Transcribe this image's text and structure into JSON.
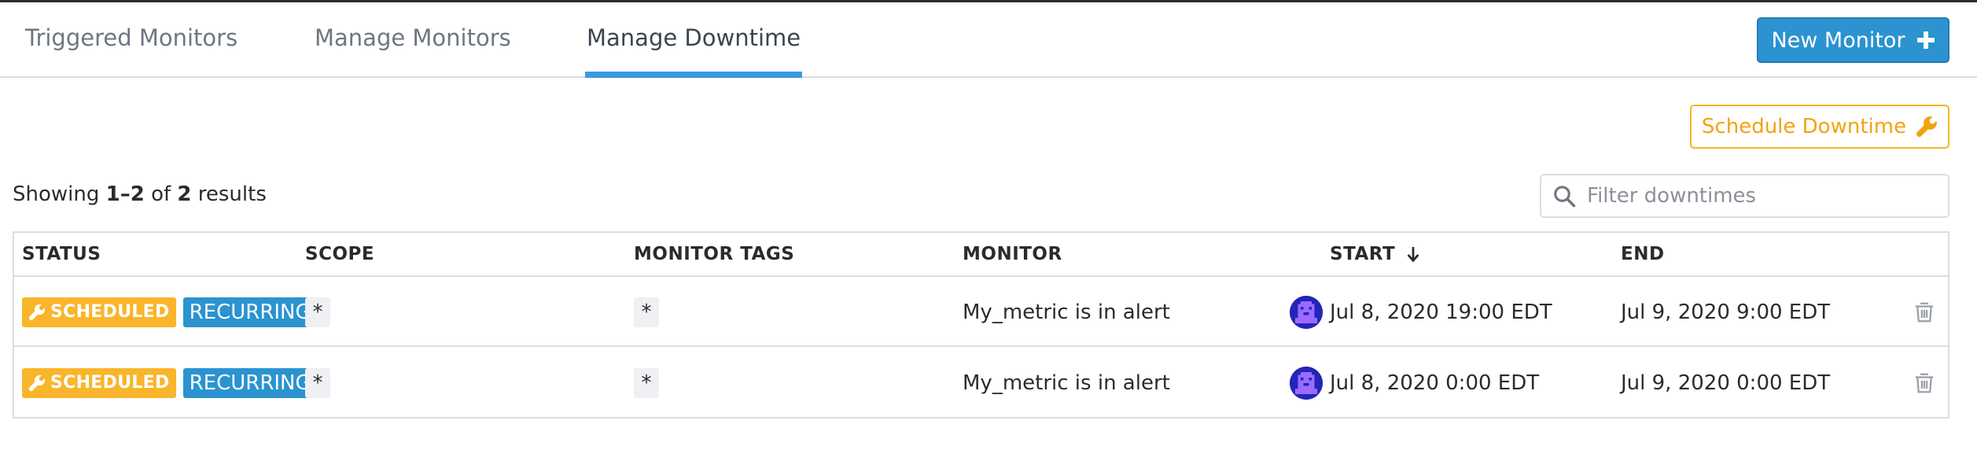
{
  "tabs": [
    {
      "label": "Triggered Monitors",
      "active": false
    },
    {
      "label": "Manage Monitors",
      "active": false
    },
    {
      "label": "Manage Downtime",
      "active": true
    }
  ],
  "actions": {
    "new_monitor_label": "New Monitor",
    "schedule_downtime_label": "Schedule Downtime"
  },
  "summary": {
    "prefix": "Showing ",
    "range": "1–2",
    "middle": " of ",
    "total": "2",
    "suffix": " results"
  },
  "filter": {
    "placeholder": "Filter downtimes",
    "value": ""
  },
  "table": {
    "headers": {
      "status": "STATUS",
      "scope": "SCOPE",
      "monitor_tags": "MONITOR TAGS",
      "monitor": "MONITOR",
      "start": "START",
      "end": "END"
    },
    "sort": {
      "column": "start",
      "direction": "descending"
    },
    "rows": [
      {
        "status": "SCHEDULED",
        "recurrence": "RECURRING",
        "scope": "*",
        "monitor_tags": "*",
        "monitor": "My_metric is in alert",
        "start": "Jul 8, 2020 19:00 EDT",
        "end": "Jul 9, 2020 9:00 EDT"
      },
      {
        "status": "SCHEDULED",
        "recurrence": "RECURRING",
        "scope": "*",
        "monitor_tags": "*",
        "monitor": "My_metric is in alert",
        "start": "Jul 8, 2020 0:00 EDT",
        "end": "Jul 9, 2020 0:00 EDT"
      }
    ]
  },
  "colors": {
    "accent_blue": "#2a93d0",
    "active_tab_underline": "#3b9be0",
    "scheduled_yellow": "#f9b52b",
    "schedule_button_orange": "#f2a310",
    "avatar_purple": "#2424b8"
  },
  "icons": {
    "new_monitor": "plus-icon",
    "schedule_downtime": "wrench-icon",
    "filter": "search-icon",
    "sort": "arrow-down-icon",
    "status": "wrench-icon",
    "row_action": "trash-icon",
    "creator": "avatar"
  }
}
